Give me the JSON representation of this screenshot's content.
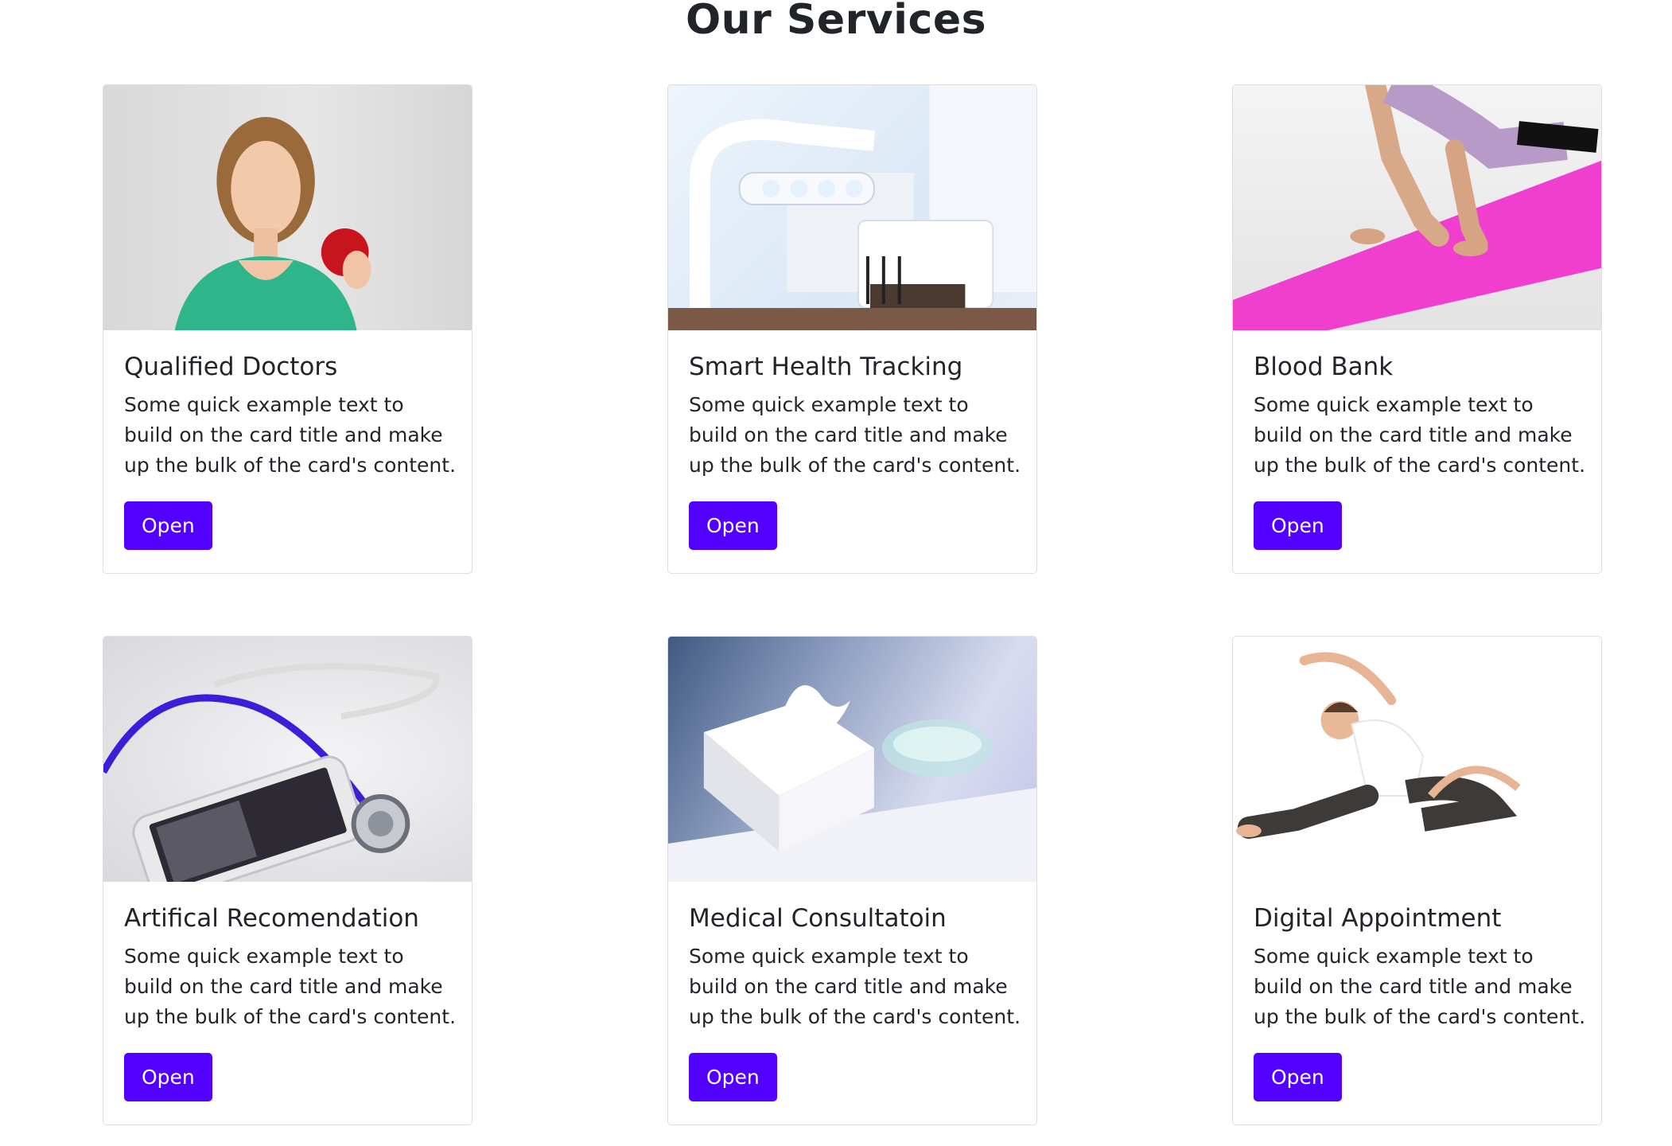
{
  "page": {
    "title": "Our Services"
  },
  "colors": {
    "accent": "#5200ff",
    "text": "#212529",
    "card_border": "#dddddd"
  },
  "cards": [
    {
      "title": "Qualified Doctors",
      "text": "Some quick example text to build on the card title and make up the bulk of the card's content.",
      "button": "Open",
      "image": "woman-holding-apple-photo"
    },
    {
      "title": "Smart Health Tracking",
      "text": "Some quick example text to build on the card title and make up the bulk of the card's content.",
      "button": "Open",
      "image": "dental-chair-light-photo"
    },
    {
      "title": "Blood Bank",
      "text": "Some quick example text to build on the card title and make up the bulk of the card's content.",
      "button": "Open",
      "image": "yoga-mat-plank-photo"
    },
    {
      "title": "Artifical Recomendation",
      "text": "Some quick example text to build on the card title and make up the bulk of the card's content.",
      "button": "Open",
      "image": "stethoscope-smartphone-photo"
    },
    {
      "title": "Medical Consultatoin",
      "text": "Some quick example text to build on the card title and make up the bulk of the card's content.",
      "button": "Open",
      "image": "tissue-box-photo"
    },
    {
      "title": "Digital Appointment",
      "text": "Some quick example text to build on the card title and make up the bulk of the card's content.",
      "button": "Open",
      "image": "woman-stretching-photo"
    }
  ]
}
